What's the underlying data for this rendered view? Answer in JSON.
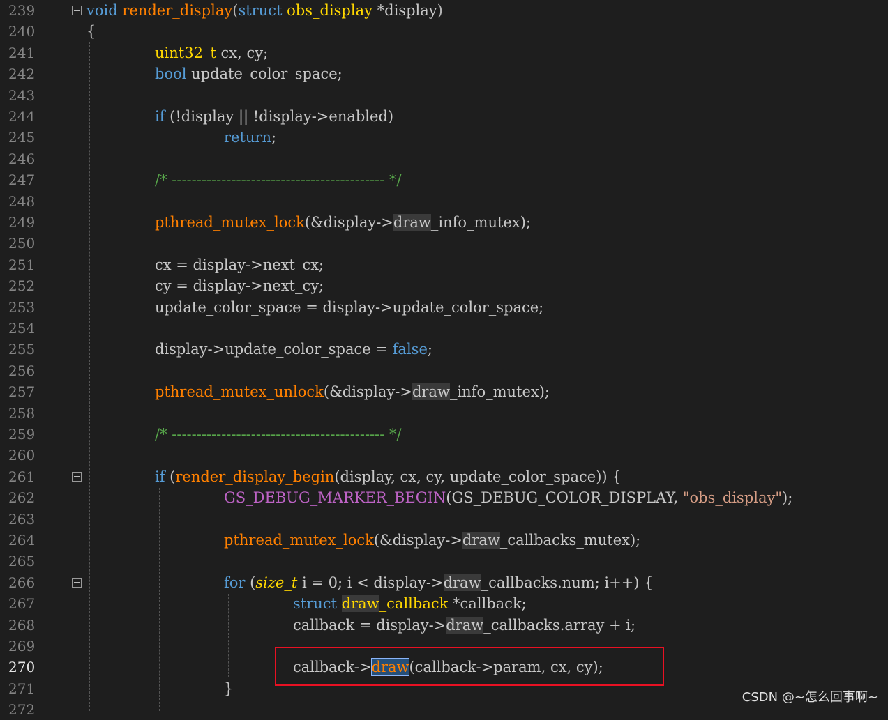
{
  "lines": [
    {
      "num": "239",
      "indent": 0,
      "tokens": [
        [
          "kw",
          "void"
        ],
        [
          "",
          ""
        ],
        [
          " ",
          "render_display"
        ],
        [
          "punct",
          "("
        ],
        [
          "kw",
          "struct"
        ],
        [
          "",
          " "
        ],
        [
          "struct",
          "obs_display"
        ],
        [
          "",
          " *display"
        ],
        [
          "punct",
          ")"
        ]
      ]
    },
    {
      "num": "240",
      "indent": 0,
      "tokens": [
        [
          "punct",
          "{"
        ]
      ]
    },
    {
      "num": "241",
      "indent": 1,
      "tokens": [
        [
          "struct",
          "uint32_t"
        ],
        [
          "",
          " cx, cy;"
        ]
      ]
    },
    {
      "num": "242",
      "indent": 1,
      "tokens": [
        [
          "kw",
          "bool"
        ],
        [
          "",
          " update_color_space;"
        ]
      ]
    },
    {
      "num": "243",
      "indent": 1,
      "tokens": []
    },
    {
      "num": "244",
      "indent": 1,
      "tokens": [
        [
          "kw",
          "if"
        ],
        [
          "",
          " (!display || !display->enabled)"
        ]
      ]
    },
    {
      "num": "245",
      "indent": 2,
      "tokens": [
        [
          "kw",
          "return"
        ],
        [
          "",
          ";"
        ]
      ]
    },
    {
      "num": "246",
      "indent": 1,
      "tokens": []
    },
    {
      "num": "247",
      "indent": 1,
      "tokens": [
        [
          "comment",
          "/* ------------------------------------------- */"
        ]
      ]
    },
    {
      "num": "248",
      "indent": 1,
      "tokens": []
    },
    {
      "num": "249",
      "indent": 1,
      "tokens": [
        [
          "fn",
          "pthread_mutex_lock"
        ],
        [
          "",
          "(&display->"
        ],
        [
          "hl",
          "draw"
        ],
        [
          "",
          "_info_mutex);"
        ]
      ]
    },
    {
      "num": "250",
      "indent": 1,
      "tokens": []
    },
    {
      "num": "251",
      "indent": 1,
      "tokens": [
        [
          "",
          "cx = display->next_cx;"
        ]
      ]
    },
    {
      "num": "252",
      "indent": 1,
      "tokens": [
        [
          "",
          "cy = display->next_cy;"
        ]
      ]
    },
    {
      "num": "253",
      "indent": 1,
      "tokens": [
        [
          "",
          "update_color_space = display->update_color_space;"
        ]
      ]
    },
    {
      "num": "254",
      "indent": 1,
      "tokens": []
    },
    {
      "num": "255",
      "indent": 1,
      "tokens": [
        [
          "",
          "display->update_color_space = "
        ],
        [
          "kw",
          "false"
        ],
        [
          "",
          ";"
        ]
      ]
    },
    {
      "num": "256",
      "indent": 1,
      "tokens": []
    },
    {
      "num": "257",
      "indent": 1,
      "tokens": [
        [
          "fn",
          "pthread_mutex_unlock"
        ],
        [
          "",
          "(&display->"
        ],
        [
          "hl",
          "draw"
        ],
        [
          "",
          "_info_mutex);"
        ]
      ]
    },
    {
      "num": "258",
      "indent": 1,
      "tokens": []
    },
    {
      "num": "259",
      "indent": 1,
      "tokens": [
        [
          "comment",
          "/* ------------------------------------------- */"
        ]
      ]
    },
    {
      "num": "260",
      "indent": 1,
      "tokens": []
    },
    {
      "num": "261",
      "indent": 1,
      "tokens": [
        [
          "kw",
          "if"
        ],
        [
          "",
          " ("
        ],
        [
          "fn",
          "render_display_begin"
        ],
        [
          "",
          "(display, cx, cy, update_color_space)) {"
        ]
      ]
    },
    {
      "num": "262",
      "indent": 2,
      "tokens": [
        [
          "macro",
          "GS_DEBUG_MARKER_BEGIN"
        ],
        [
          "",
          "(GS_DEBUG_COLOR_DISPLAY, "
        ],
        [
          "str",
          "\"obs_display\""
        ],
        [
          "",
          ");"
        ]
      ]
    },
    {
      "num": "263",
      "indent": 2,
      "tokens": []
    },
    {
      "num": "264",
      "indent": 2,
      "tokens": [
        [
          "fn",
          "pthread_mutex_lock"
        ],
        [
          "",
          "(&display->"
        ],
        [
          "hl",
          "draw"
        ],
        [
          "",
          "_callbacks_mutex);"
        ]
      ]
    },
    {
      "num": "265",
      "indent": 2,
      "tokens": []
    },
    {
      "num": "266",
      "indent": 2,
      "tokens": [
        [
          "kw",
          "for"
        ],
        [
          "",
          " ("
        ],
        [
          "struct italic",
          "size_t"
        ],
        [
          "",
          " i = 0; i < display->"
        ],
        [
          "hl",
          "draw"
        ],
        [
          "",
          "_callbacks.num; i++) {"
        ]
      ]
    },
    {
      "num": "267",
      "indent": 3,
      "tokens": [
        [
          "kw",
          "struct"
        ],
        [
          "",
          " "
        ],
        [
          "struct hl",
          "draw"
        ],
        [
          "struct",
          "_callback"
        ],
        [
          "",
          " *callback;"
        ]
      ]
    },
    {
      "num": "268",
      "indent": 3,
      "tokens": [
        [
          "",
          "callback = display->"
        ],
        [
          "hl",
          "draw"
        ],
        [
          "",
          "_callbacks.array + i;"
        ]
      ]
    },
    {
      "num": "269",
      "indent": 3,
      "tokens": []
    },
    {
      "num": "270",
      "indent": 3,
      "active": true,
      "tokens": [
        [
          "",
          "callback->"
        ],
        [
          "fn sel",
          "draw"
        ],
        [
          "",
          "(callback->param, cx, cy);"
        ]
      ]
    },
    {
      "num": "271",
      "indent": 2,
      "tokens": [
        [
          "",
          "}"
        ]
      ]
    },
    {
      "num": "272",
      "indent": 2,
      "tokens": []
    }
  ],
  "watermark": "CSDN @~怎么回事啊~"
}
